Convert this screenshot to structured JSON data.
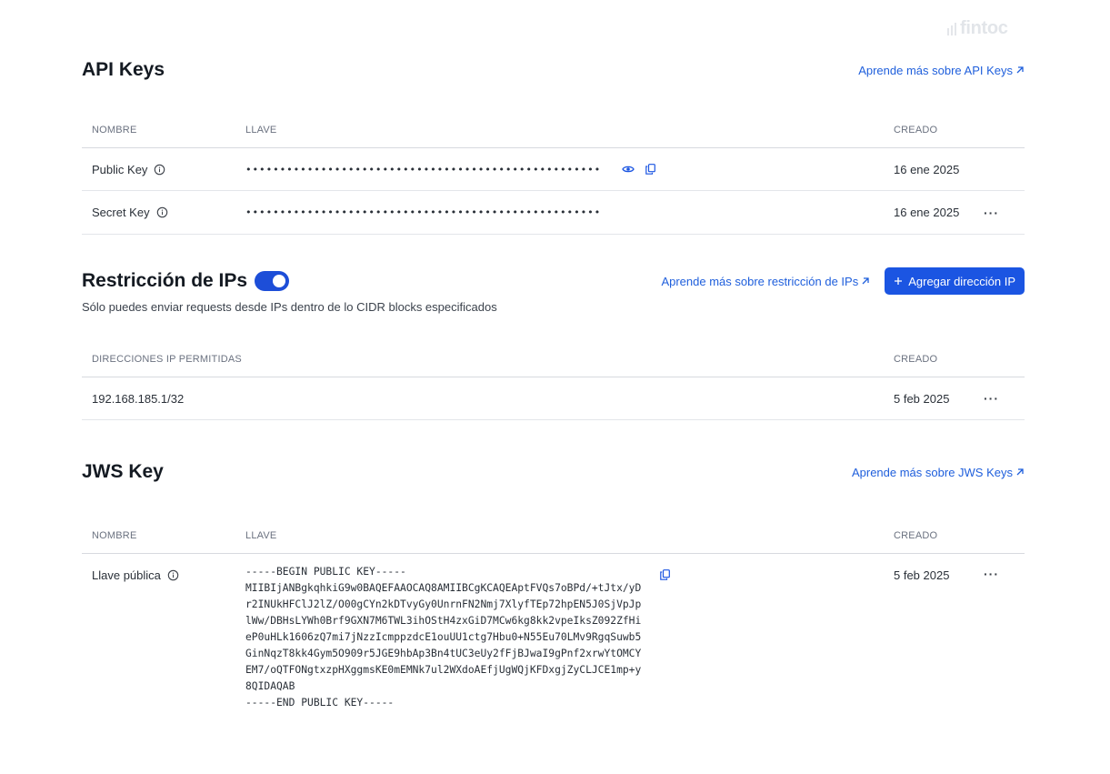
{
  "brand": {
    "logo_text": "fintoc"
  },
  "api_keys": {
    "title": "API Keys",
    "learn_link": "Aprende más sobre API Keys",
    "columns": {
      "name": "NOMBRE",
      "key": "LLAVE",
      "created": "CREADO"
    },
    "rows": [
      {
        "name": "Public Key",
        "key": "••••••••••••••••••••••••••••••••••••••••••••••••••••",
        "created": "16 ene 2025"
      },
      {
        "name": "Secret Key",
        "key": "••••••••••••••••••••••••••••••••••••••••••••••••••••",
        "created": "16 ene 2025"
      }
    ]
  },
  "ip_restriction": {
    "title": "Restricción de IPs",
    "enabled": true,
    "subtitle": "Sólo puedes enviar requests desde IPs dentro de lo CIDR blocks especificados",
    "learn_link": "Aprende más sobre restricción de IPs",
    "add_button": "Agregar dirección IP",
    "columns": {
      "ips": "DIRECCIONES IP PERMITIDAS",
      "created": "CREADO"
    },
    "rows": [
      {
        "ip": "192.168.185.1/32",
        "created": "5 feb 2025"
      }
    ]
  },
  "jws_key": {
    "title": "JWS Key",
    "learn_link": "Aprende más sobre JWS Keys",
    "columns": {
      "name": "NOMBRE",
      "key": "LLAVE",
      "created": "CREADO"
    },
    "row": {
      "name": "Llave pública",
      "key": "-----BEGIN PUBLIC KEY-----\nMIIBIjANBgkqhkiG9w0BAQEFAAOCAQ8AMIIBCgKCAQEAptFVQs7oBPd/+tJtx/yD\nr2INUkHFClJ2lZ/O00gCYn2kDTvyGy0UnrnFN2Nmj7XlyfTEp72hpEN5J0SjVpJp\nlWw/DBHsLYWh0Brf9GXN7M6TWL3ihOStH4zxGiD7MCw6kg8kk2vpeIksZ092ZfHi\neP0uHLk1606zQ7mi7jNzzIcmppzdcE1ouUU1ctg7Hbu0+N55Eu70LMv9RgqSuwb5\nGinNqzT8kk4Gym5O909r5JGE9hbAp3Bn4tUC3eUy2fFjBJwaI9gPnf2xrwYtOMCY\nEM7/oQTFONgtxzpHXggmsKE0mEMNk7ul2WXdoAEfjUgWQjKFDxgjZyCLJCE1mp+y\n8QIDAQAB\n-----END PUBLIC KEY-----",
      "created": "5 feb 2025"
    }
  },
  "colors": {
    "accent": "#1b55e2",
    "link": "#1f5fdc",
    "border": "#d7dadf"
  }
}
